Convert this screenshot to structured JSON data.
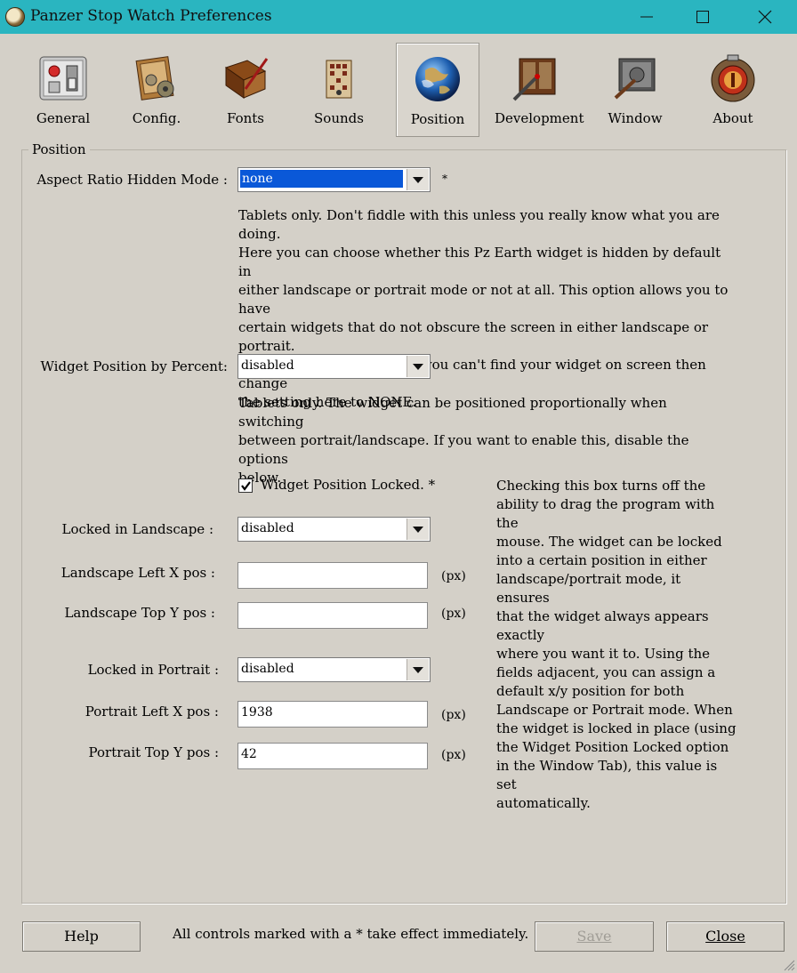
{
  "window": {
    "title": "Panzer Stop Watch Preferences"
  },
  "tabs": [
    {
      "label": "General",
      "icon": "switches-icon"
    },
    {
      "label": "Config.",
      "icon": "gears-icon"
    },
    {
      "label": "Fonts",
      "icon": "book-pen-icon"
    },
    {
      "label": "Sounds",
      "icon": "speaker-icon"
    },
    {
      "label": "Position",
      "icon": "globe-icon",
      "selected": true
    },
    {
      "label": "Development",
      "icon": "machine-icon"
    },
    {
      "label": "Window",
      "icon": "window-icon"
    },
    {
      "label": "About",
      "icon": "about-icon"
    }
  ],
  "group": {
    "title": "Position"
  },
  "aspect": {
    "label": "Aspect Ratio Hidden Mode :",
    "value": "none",
    "star": "*",
    "desc": [
      "Tablets only. Don't fiddle with this unless you really know what you are doing.",
      "Here you can choose whether this Pz Earth widget is hidden by default in",
      "either landscape or portrait mode or not at all. This option allows you to have",
      "certain widgets that do not obscure the screen in either landscape or portrait.",
      "If you accidentally set it so you can't find your widget on screen then change",
      "the setting here to NONE."
    ]
  },
  "percent": {
    "label": "Widget Position by Percent:",
    "value": "disabled",
    "desc": [
      "Tablets only. The widget can be positioned proportionally when switching",
      "between portrait/landscape. If you want to enable this, disable the options",
      "below."
    ]
  },
  "locked": {
    "checkbox_label": "Widget Position Locked. *",
    "checked": true,
    "desc": [
      "Checking this box turns off the",
      "ability to drag the program with the",
      "mouse. The widget can be locked",
      "into a certain position in either",
      "landscape/portrait mode, it ensures",
      "that the widget always appears exactly",
      "where you want it to. Using the",
      "fields adjacent, you can assign a",
      "default x/y position for both",
      "Landscape or Portrait mode. When",
      "the widget is locked in place (using",
      "the Widget Position Locked option",
      "in the Window Tab), this value is set",
      "automatically."
    ]
  },
  "landscape": {
    "locked_label": "Locked in Landscape :",
    "locked_value": "disabled",
    "left_label": "Landscape Left X pos :",
    "left_value": "",
    "top_label": "Landscape Top Y pos :",
    "top_value": ""
  },
  "portrait": {
    "locked_label": "Locked in Portrait :",
    "locked_value": "disabled",
    "left_label": "Portrait Left X pos :",
    "left_value": "1938",
    "top_label": "Portrait Top Y pos :",
    "top_value": "42"
  },
  "unit": "(px)",
  "footer": {
    "help": "Help",
    "note": "All controls marked with a * take effect immediately.",
    "save": "Save",
    "close": "Close"
  }
}
